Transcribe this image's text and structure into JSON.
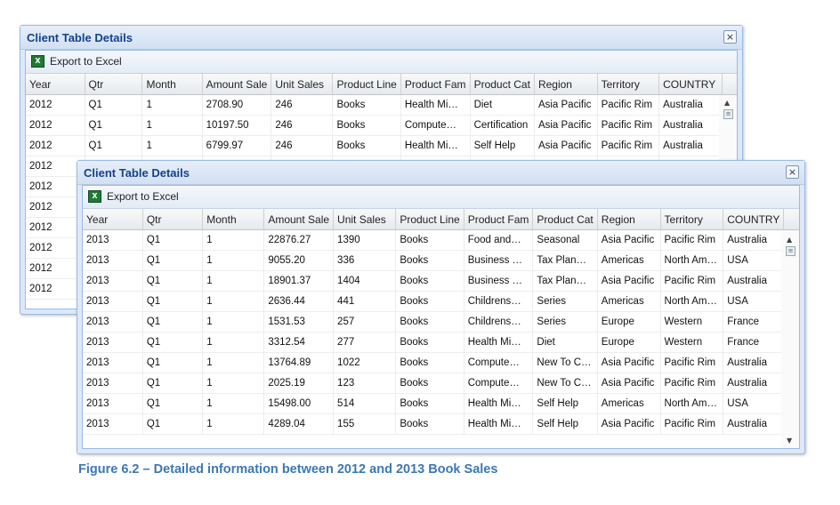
{
  "windows": [
    {
      "title": "Client Table Details",
      "close_label": "×",
      "export_icon": "X",
      "export_label": "Export to Excel",
      "columns": [
        "Year",
        "Qtr",
        "Month",
        "Amount Sale",
        "Unit Sales",
        "Product Line",
        "Product Fam",
        "Product Cat",
        "Region",
        "Territory",
        "COUNTRY"
      ],
      "rows": [
        [
          "2012",
          "Q1",
          "1",
          "2708.90",
          "246",
          "Books",
          "Health Mi…",
          "Diet",
          "Asia Pacific",
          "Pacific Rim",
          "Australia"
        ],
        [
          "2012",
          "Q1",
          "1",
          "10197.50",
          "246",
          "Books",
          "Compute…",
          "Certification",
          "Asia Pacific",
          "Pacific Rim",
          "Australia"
        ],
        [
          "2012",
          "Q1",
          "1",
          "6799.97",
          "246",
          "Books",
          "Health Mi…",
          "Self Help",
          "Asia Pacific",
          "Pacific Rim",
          "Australia"
        ],
        [
          "2012",
          "",
          "",
          "",
          "",
          "",
          "",
          "",
          "",
          "",
          ""
        ],
        [
          "2012",
          "",
          "",
          "",
          "",
          "",
          "",
          "",
          "",
          "",
          ""
        ],
        [
          "2012",
          "",
          "",
          "",
          "",
          "",
          "",
          "",
          "",
          "",
          ""
        ],
        [
          "2012",
          "",
          "",
          "",
          "",
          "",
          "",
          "",
          "",
          "",
          ""
        ],
        [
          "2012",
          "",
          "",
          "",
          "",
          "",
          "",
          "",
          "",
          "",
          ""
        ],
        [
          "2012",
          "",
          "",
          "",
          "",
          "",
          "",
          "",
          "",
          "",
          ""
        ],
        [
          "2012",
          "",
          "",
          "",
          "",
          "",
          "",
          "",
          "",
          "",
          ""
        ]
      ]
    },
    {
      "title": "Client Table Details",
      "close_label": "×",
      "export_icon": "X",
      "export_label": "Export to Excel",
      "columns": [
        "Year",
        "Qtr",
        "Month",
        "Amount Sale",
        "Unit Sales",
        "Product Line",
        "Product Fam",
        "Product Cat",
        "Region",
        "Territory",
        "COUNTRY"
      ],
      "rows": [
        [
          "2013",
          "Q1",
          "1",
          "22876.27",
          "1390",
          "Books",
          "Food and…",
          "Seasonal",
          "Asia Pacific",
          "Pacific Rim",
          "Australia"
        ],
        [
          "2013",
          "Q1",
          "1",
          "9055.20",
          "336",
          "Books",
          "Business …",
          "Tax Plan…",
          "Americas",
          "North Am…",
          "USA"
        ],
        [
          "2013",
          "Q1",
          "1",
          "18901.37",
          "1404",
          "Books",
          "Business …",
          "Tax Plan…",
          "Asia Pacific",
          "Pacific Rim",
          "Australia"
        ],
        [
          "2013",
          "Q1",
          "1",
          "2636.44",
          "441",
          "Books",
          "Childrens…",
          "Series",
          "Americas",
          "North Am…",
          "USA"
        ],
        [
          "2013",
          "Q1",
          "1",
          "1531.53",
          "257",
          "Books",
          "Childrens…",
          "Series",
          "Europe",
          "Western",
          "France"
        ],
        [
          "2013",
          "Q1",
          "1",
          "3312.54",
          "277",
          "Books",
          "Health Mi…",
          "Diet",
          "Europe",
          "Western",
          "France"
        ],
        [
          "2013",
          "Q1",
          "1",
          "13764.89",
          "1022",
          "Books",
          "Compute…",
          "New To C…",
          "Asia Pacific",
          "Pacific Rim",
          "Australia"
        ],
        [
          "2013",
          "Q1",
          "1",
          "2025.19",
          "123",
          "Books",
          "Compute…",
          "New To C…",
          "Asia Pacific",
          "Pacific Rim",
          "Australia"
        ],
        [
          "2013",
          "Q1",
          "1",
          "15498.00",
          "514",
          "Books",
          "Health Mi…",
          "Self Help",
          "Americas",
          "North Am…",
          "USA"
        ],
        [
          "2013",
          "Q1",
          "1",
          "4289.04",
          "155",
          "Books",
          "Health Mi…",
          "Self Help",
          "Asia Pacific",
          "Pacific Rim",
          "Australia"
        ]
      ]
    }
  ],
  "caption": "Figure 6.2 – Detailed information between 2012 and 2013 Book Sales",
  "colors": {
    "title_text": "#15428b",
    "window_frame": "#99bbe8",
    "caption": "#3c78b4"
  },
  "icons": {
    "close": "close-icon",
    "export": "excel-icon",
    "scroll_up": "arrow-up-icon",
    "scroll_down": "arrow-down-icon",
    "scroll_grip": "scroll-grip-icon"
  }
}
